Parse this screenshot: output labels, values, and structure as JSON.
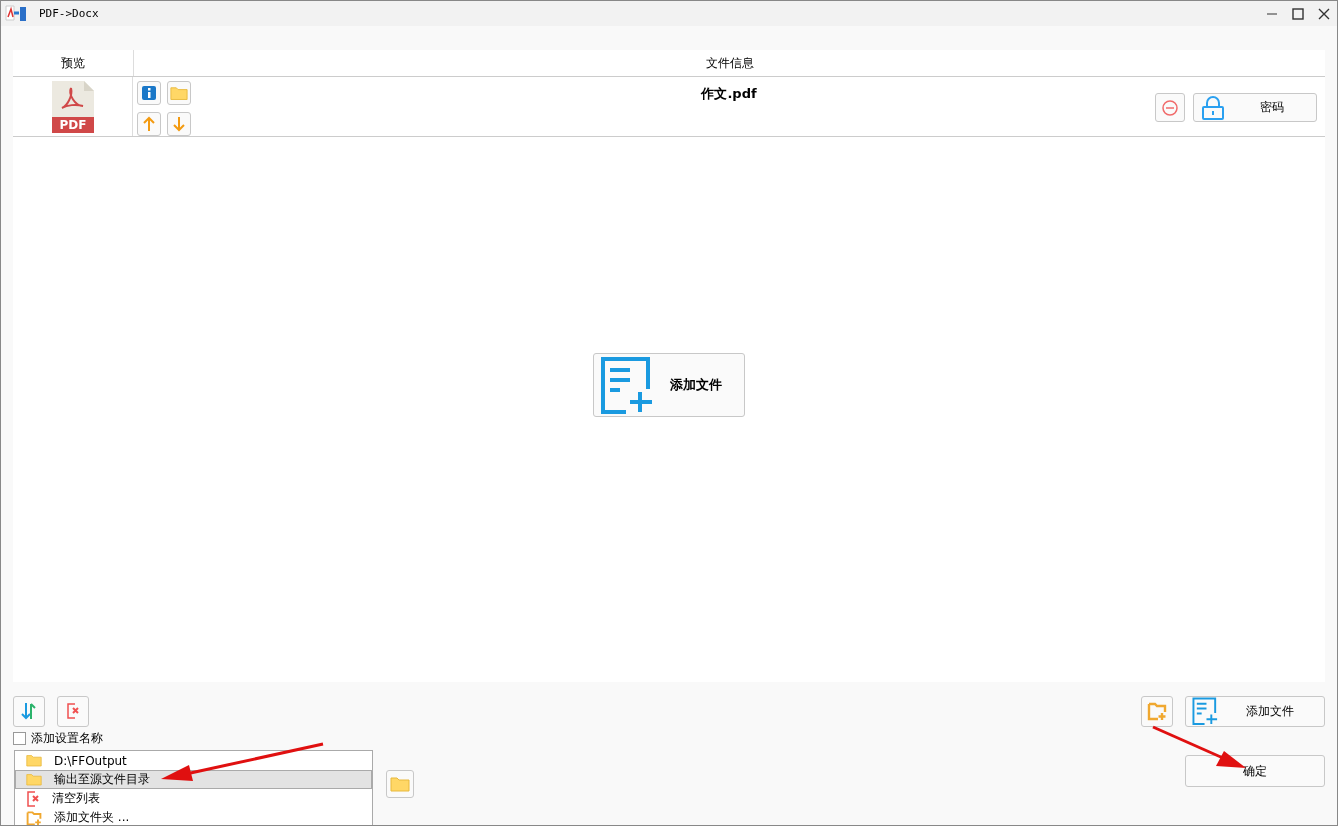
{
  "window": {
    "title": "PDF->Docx"
  },
  "table": {
    "columns": [
      "预览",
      "文件信息"
    ],
    "rows": [
      {
        "preview": "PDF",
        "file_name": "作文.pdf",
        "password_button": "密码"
      }
    ]
  },
  "center_add_button": "添加文件",
  "toolbar": {
    "add_file_button": "添加文件"
  },
  "options": {
    "label": "添加设置名称",
    "checked": false
  },
  "output_menu": {
    "items": [
      {
        "label": "D:\\FFOutput",
        "kind": "folder",
        "selected": false
      },
      {
        "label": "输出至源文件目录",
        "kind": "folder",
        "selected": true
      },
      {
        "label": "清空列表",
        "kind": "clear",
        "selected": false
      },
      {
        "label": "添加文件夹 ...",
        "kind": "add-folder",
        "selected": false
      }
    ]
  },
  "confirm_button": "确定"
}
